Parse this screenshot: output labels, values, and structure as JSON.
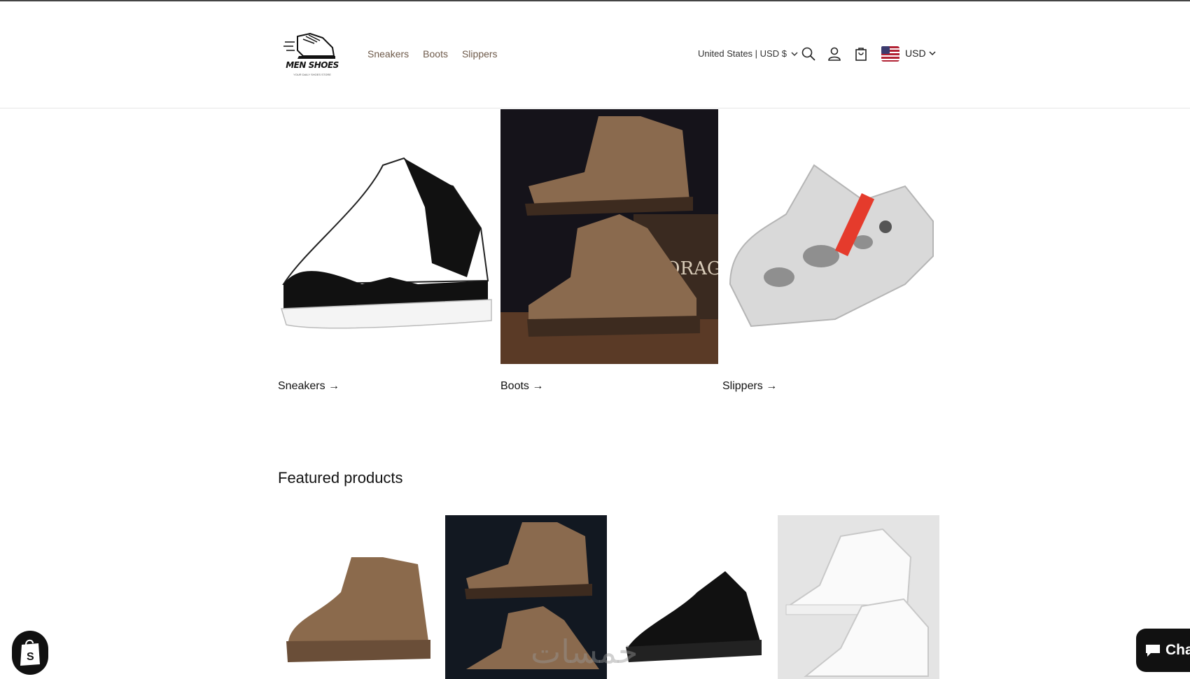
{
  "brand": {
    "logo_text": "MEN SHOES",
    "tagline": "YOUR DAILY SHOES STORE"
  },
  "nav": {
    "items": [
      {
        "label": "Sneakers"
      },
      {
        "label": "Boots"
      },
      {
        "label": "Slippers"
      }
    ]
  },
  "header": {
    "country_selector": "United States | USD $",
    "currency_label": "USD",
    "icons": [
      "search-icon",
      "account-icon",
      "cart-icon",
      "us-flag-icon"
    ]
  },
  "collections": [
    {
      "label": "Sneakers →"
    },
    {
      "label": "Boots →"
    },
    {
      "label": "Slippers →"
    }
  ],
  "featured": {
    "title": "Featured products"
  },
  "widgets": {
    "chat_label": "Cha",
    "watermark": "خمسات"
  },
  "colors": {
    "nav_link": "#6e5a4a",
    "text": "#121212",
    "boot_brown": "#8a6a4e",
    "dark_bg": "#121821"
  }
}
